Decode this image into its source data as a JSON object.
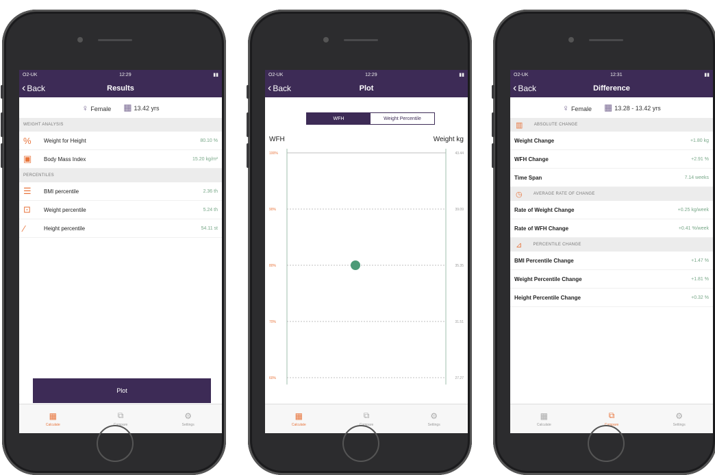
{
  "status": {
    "carrier": "O2-UK",
    "battery": "▮"
  },
  "results": {
    "time": "12:29",
    "back": "Back",
    "title": "Results",
    "gender": "Female",
    "age": "13.42 yrs",
    "sections": [
      {
        "label": "WEIGHT ANALYSIS",
        "rows": [
          {
            "icon": "percent-icon",
            "label": "Weight for Height",
            "value": "80.10 %"
          },
          {
            "icon": "scale-icon",
            "label": "Body Mass Index",
            "value": "15.20 kg/m²"
          }
        ]
      },
      {
        "label": "PERCENTILES",
        "rows": [
          {
            "icon": "stack-icon",
            "label": "BMI percentile",
            "value": "2.36 th"
          },
          {
            "icon": "weight-box-icon",
            "label": "Weight percentile",
            "value": "5.24 th"
          },
          {
            "icon": "ruler-icon",
            "label": "Height percentile",
            "value": "54.11 st"
          }
        ]
      }
    ],
    "plot_button": "Plot"
  },
  "plot": {
    "time": "12:29",
    "back": "Back",
    "title": "Plot",
    "segments": [
      "WFH",
      "Weight Percentile"
    ],
    "left_label": "WFH",
    "right_label": "Weight kg"
  },
  "chart_data": {
    "type": "scatter",
    "left_ticks": [
      "100%",
      "90%",
      "80%",
      "70%",
      "60%"
    ],
    "right_ticks": [
      "43.44",
      "39.09",
      "35.35",
      "31.51",
      "27.27"
    ],
    "x": [],
    "points": [
      {
        "y": 80
      }
    ],
    "ylim": [
      60,
      100
    ],
    "grid": true
  },
  "difference": {
    "time": "12:31",
    "back": "Back",
    "title": "Difference",
    "gender": "Female",
    "age_range": "13.28 - 13.42 yrs",
    "sections": [
      {
        "label": "ABSOLUTE CHANGE",
        "icon": "bar-chart-icon",
        "rows": [
          {
            "label": "Weight Change",
            "value": "+1.80 kg"
          },
          {
            "label": "WFH Change",
            "value": "+2.91 %"
          },
          {
            "label": "Time Span",
            "value": "7.14 weeks"
          }
        ]
      },
      {
        "label": "AVERAGE RATE OF CHANGE",
        "icon": "stopwatch-icon",
        "rows": [
          {
            "label": "Rate of Weight Change",
            "value": "+0.25 kg/week"
          },
          {
            "label": "Rate of WFH Change",
            "value": "+0.41 %/week"
          }
        ]
      },
      {
        "label": "PERCENTILE CHANGE",
        "icon": "percentile-chart-icon",
        "rows": [
          {
            "label": "BMI Percentile Change",
            "value": "+1.47 %"
          },
          {
            "label": "Weight Percentile Change",
            "value": "+1.81 %"
          },
          {
            "label": "Height Percentile Change",
            "value": "+0.32 %"
          }
        ]
      }
    ]
  },
  "tabs": [
    "Calculate",
    "Compare",
    "Settings"
  ]
}
